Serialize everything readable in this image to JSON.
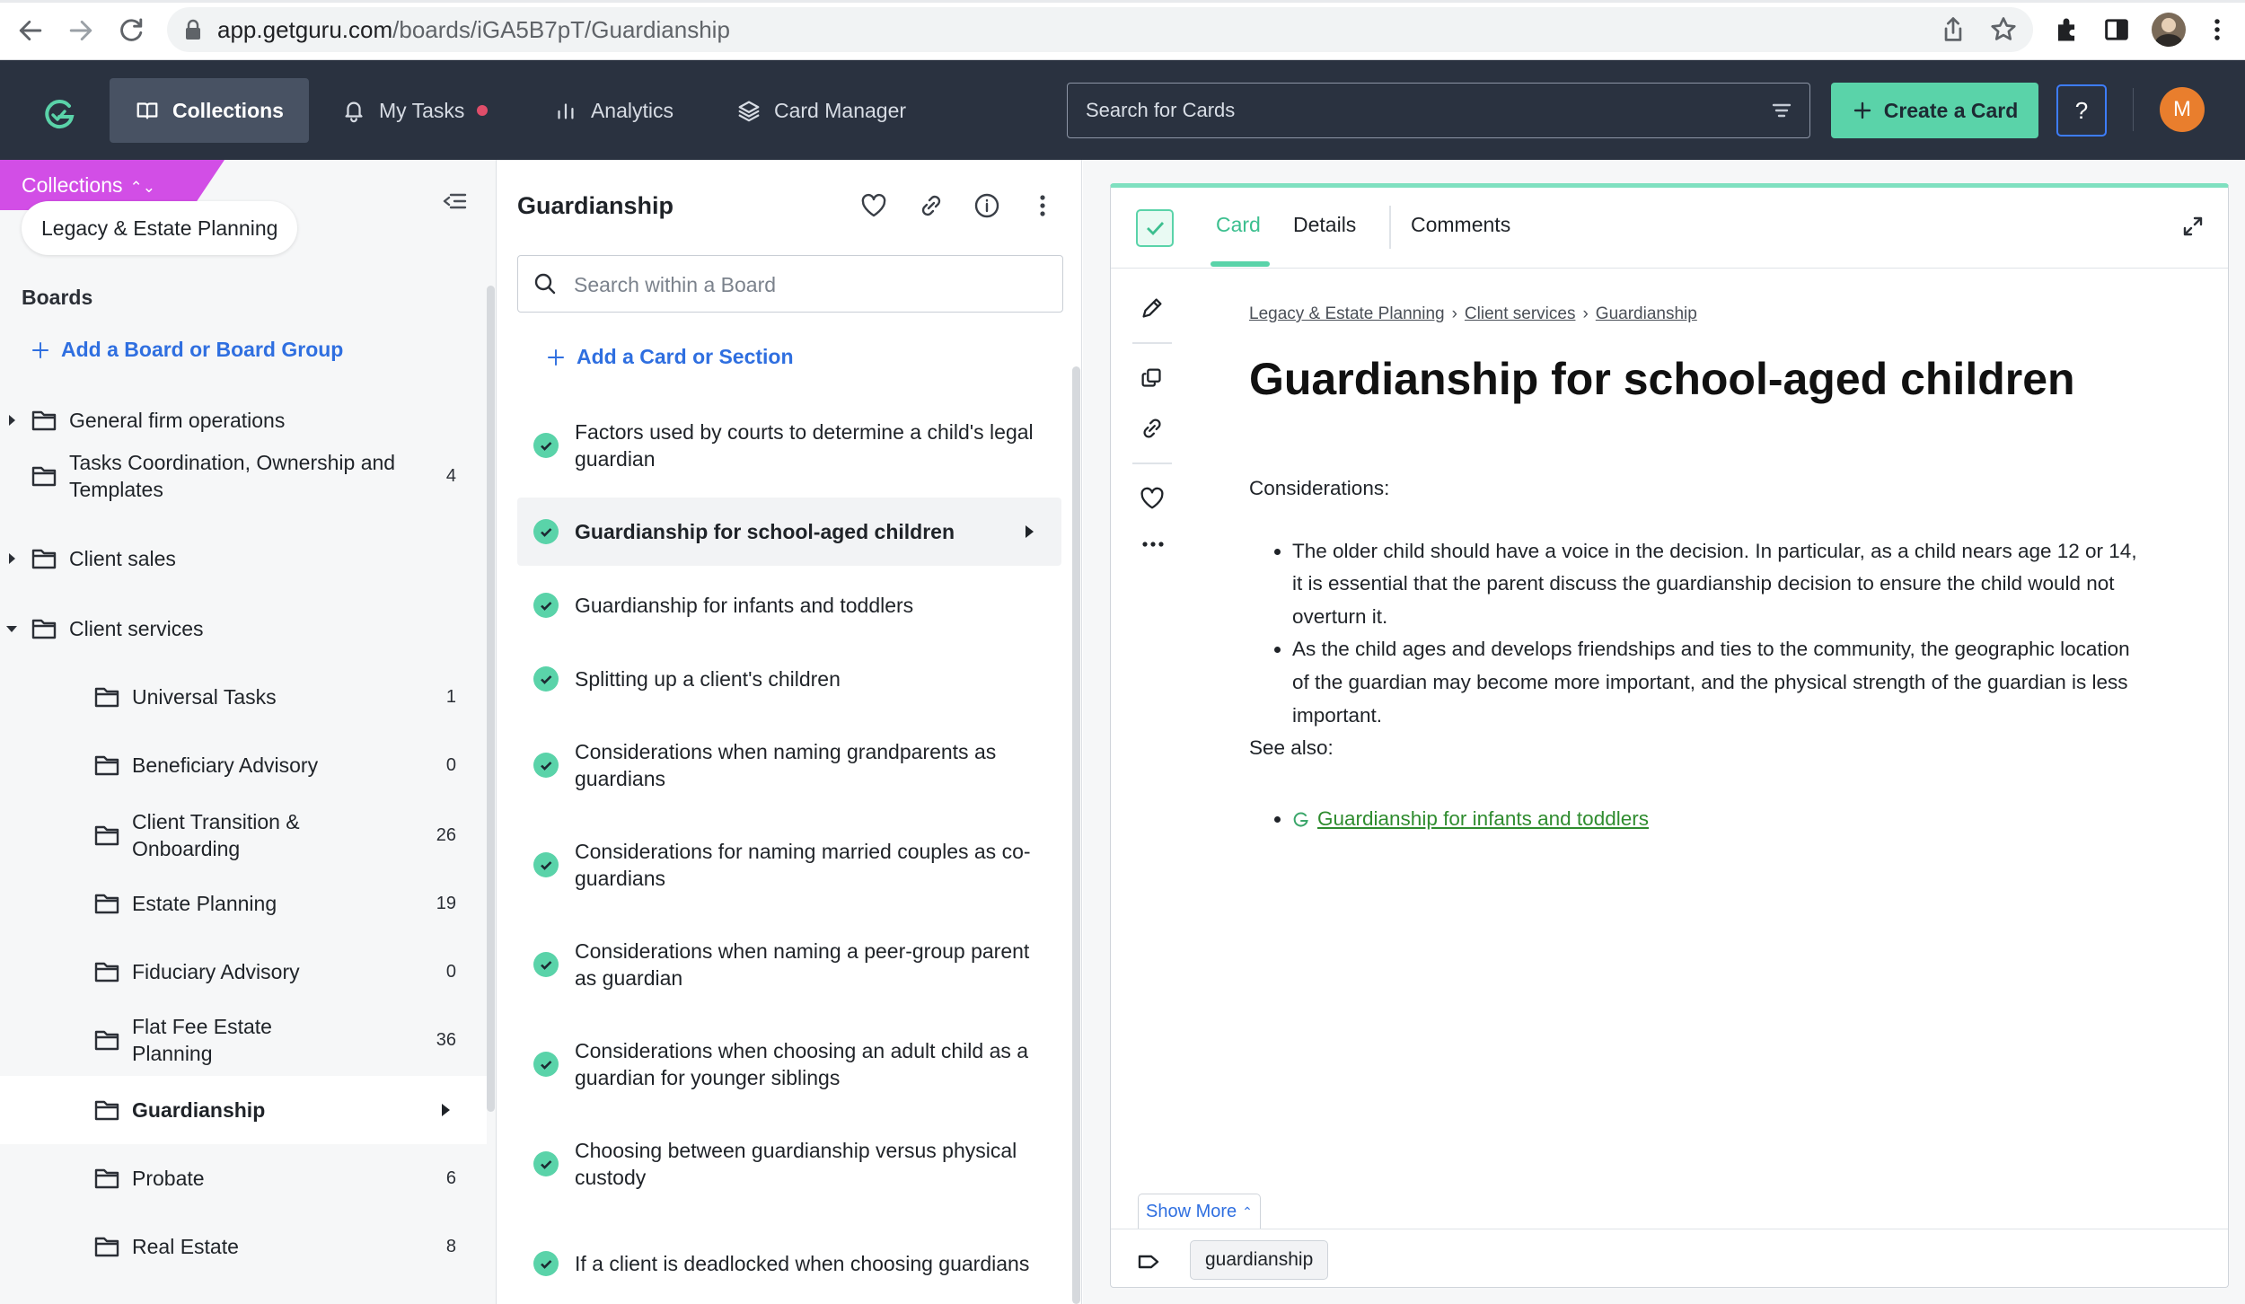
{
  "browser": {
    "url_host": "app.getguru.com",
    "url_path": "/boards/iGA5B7pT/Guardianship"
  },
  "nav": {
    "items": [
      {
        "label": "Collections",
        "icon": "book-icon"
      },
      {
        "label": "My Tasks",
        "icon": "bell-icon"
      },
      {
        "label": "Analytics",
        "icon": "bar-chart-icon"
      },
      {
        "label": "Card Manager",
        "icon": "layers-icon"
      }
    ],
    "search_placeholder": "Search for Cards",
    "create_label": "Create a Card",
    "help_label": "?",
    "avatar_initial": "M"
  },
  "sidebar": {
    "collections_label": "Collections",
    "collection_name": "Legacy & Estate Planning",
    "boards_heading": "Boards",
    "add_board_label": "Add a Board or Board Group",
    "boards": [
      {
        "name": "General firm operations",
        "count": "",
        "expandable": true,
        "expanded": false,
        "level": 0
      },
      {
        "name": "Tasks Coordination, Ownership and Templates",
        "count": "4",
        "expandable": false,
        "level": 0
      },
      {
        "name": "Client sales",
        "count": "",
        "expandable": true,
        "expanded": false,
        "level": 0
      },
      {
        "name": "Client services",
        "count": "",
        "expandable": true,
        "expanded": true,
        "level": 0
      },
      {
        "name": "Universal Tasks",
        "count": "1",
        "level": 1
      },
      {
        "name": "Beneficiary Advisory",
        "count": "0",
        "level": 1
      },
      {
        "name": "Client Transition & Onboarding",
        "count": "26",
        "level": 1
      },
      {
        "name": "Estate Planning",
        "count": "19",
        "level": 1
      },
      {
        "name": "Fiduciary Advisory",
        "count": "0",
        "level": 1
      },
      {
        "name": "Flat Fee Estate Planning",
        "count": "36",
        "level": 1
      },
      {
        "name": "Guardianship",
        "count": "",
        "level": 1,
        "selected": true
      },
      {
        "name": "Probate",
        "count": "6",
        "level": 1
      },
      {
        "name": "Real Estate",
        "count": "8",
        "level": 1
      }
    ]
  },
  "board": {
    "title": "Guardianship",
    "search_placeholder": "Search within a Board",
    "add_card_label": "Add a Card or Section",
    "cards": [
      {
        "title": "Factors used by courts to determine a child's legal guardian"
      },
      {
        "title": "Guardianship for school-aged children",
        "selected": true
      },
      {
        "title": "Guardianship for infants and toddlers"
      },
      {
        "title": "Splitting up a client's children"
      },
      {
        "title": "Considerations when naming grandparents as guardians"
      },
      {
        "title": "Considerations for naming married couples as co-guardians"
      },
      {
        "title": "Considerations when naming a peer-group parent as guardian"
      },
      {
        "title": "Considerations when choosing an adult child as a guardian for younger siblings"
      },
      {
        "title": "Choosing between guardianship versus physical custody"
      },
      {
        "title": "If a client is deadlocked when choosing guardians"
      }
    ]
  },
  "card": {
    "tabs": [
      "Card",
      "Details",
      "Comments"
    ],
    "breadcrumb": [
      "Legacy & Estate Planning",
      "Client services",
      "Guardianship"
    ],
    "breadcrumb_sep": "›",
    "title": "Guardianship for school-aged children",
    "considerations_label": "Considerations:",
    "bullets": [
      "The older child should have a voice in the decision. In particular, as a child nears age 12 or 14, it is essential that the parent discuss the guardianship decision to ensure the child would not overturn it.",
      "As the child ages and develops friendships and ties to the community, the geographic location of the guardian may become more important, and the physical strength of the guardian is less important."
    ],
    "see_also_label": "See also:",
    "see_also_links": [
      "Guardianship for infants and toddlers"
    ],
    "show_more_label": "Show More",
    "tag": "guardianship"
  },
  "colors": {
    "nav_bg": "#2a3240",
    "accent_green": "#5ad3a9",
    "link_blue": "#2f6fe0",
    "collections_magenta": "#d24ee6",
    "avatar_orange": "#e97e2d",
    "link_green": "#2f8c2f"
  }
}
